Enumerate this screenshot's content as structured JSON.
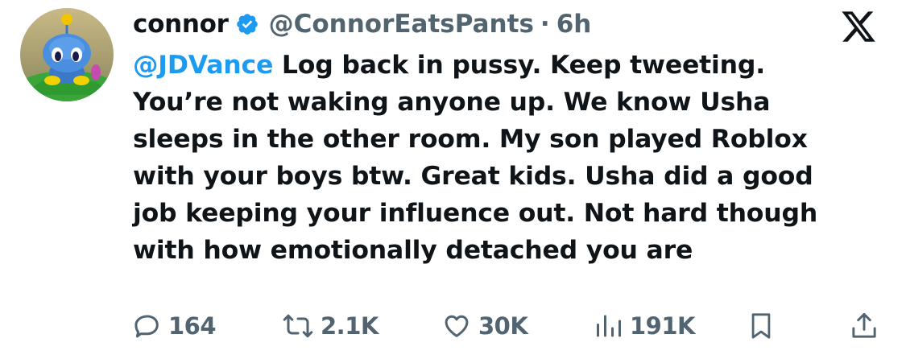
{
  "author": {
    "name": "connor",
    "handle": "@ConnorEatsPants",
    "separator": "·",
    "time": "6h",
    "verified": true,
    "avatar": "chao-character-avatar"
  },
  "platform_logo": "x-logo-icon",
  "tweet": {
    "mention": "@JDVance",
    "lines": [
      " Log back in pussy. Keep tweeting.",
      "You’re not waking anyone up. We know Usha",
      "sleeps in the other room. My son played Roblox",
      "with your boys btw. Great kids. Usha did a good",
      "job keeping your influence out. Not hard though",
      "with how emotionally detached you are"
    ]
  },
  "actions": {
    "replies": "164",
    "reposts": "2.1K",
    "likes": "30K",
    "views": "191K",
    "bookmark_icon": "bookmark-icon",
    "share_icon": "share-icon"
  },
  "colors": {
    "text": "#0f1419",
    "secondary": "#536471",
    "accent": "#1d9bf0",
    "background": "#ffffff"
  }
}
